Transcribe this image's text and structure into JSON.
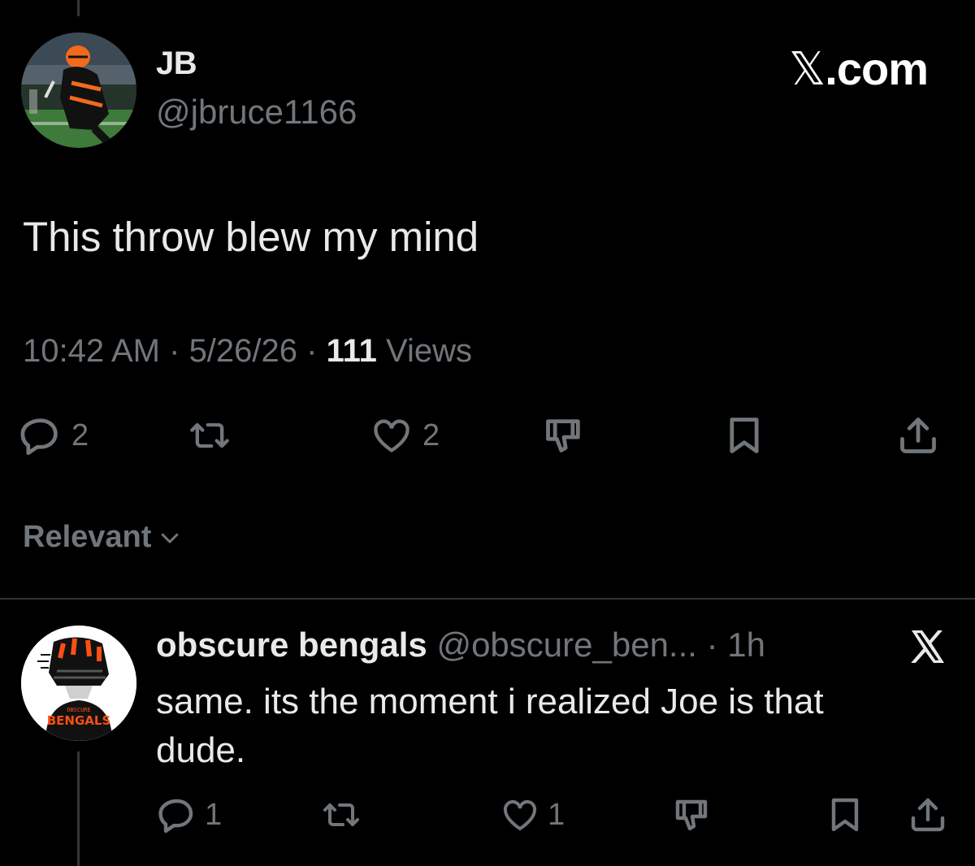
{
  "brand": {
    "text_x": "𝕏",
    "text_suffix": ".com"
  },
  "tweet": {
    "author_name": "JB",
    "author_handle": "@jbruce1166",
    "text": "This throw blew my mind",
    "time": "10:42 AM",
    "sep1": " · ",
    "date": "5/26/26",
    "sep2": " · ",
    "views_count": "111",
    "views_label": " Views",
    "reply_count": "2",
    "like_count": "2"
  },
  "sort": {
    "label": "Relevant"
  },
  "reply": {
    "author_name": "obscure bengals",
    "author_handle": "@obscure_ben...",
    "sep": " · ",
    "time": "1h",
    "text": "same. its the moment i realized Joe is that dude.",
    "reply_count": "1",
    "like_count": "1",
    "avatar_small_text": "OBSCURE",
    "avatar_big_text": "BENGALS"
  },
  "icons": {
    "reply": "reply-icon",
    "retweet": "retweet-icon",
    "like": "heart-icon",
    "dislike": "thumbs-down-icon",
    "bookmark": "bookmark-icon",
    "share": "share-icon",
    "chevron": "chevron-down-icon",
    "x_logo": "x-logo-icon"
  },
  "colors": {
    "background": "#000000",
    "text": "#e7e9ea",
    "muted": "#71767b",
    "divider": "#2f3336",
    "bengals_orange": "#fb4f14"
  }
}
